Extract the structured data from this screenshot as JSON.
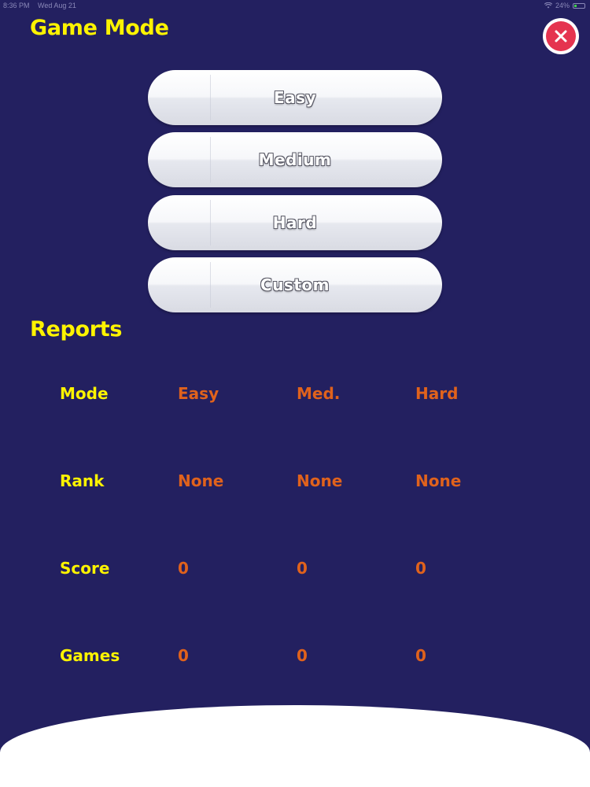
{
  "status_bar": {
    "time": "8:36 PM",
    "date": "Wed Aug 21",
    "battery": "24%"
  },
  "game_mode": {
    "title": "Game Mode",
    "buttons": [
      {
        "label": "Easy"
      },
      {
        "label": "Medium"
      },
      {
        "label": "Hard"
      },
      {
        "label": "Custom"
      }
    ]
  },
  "reports": {
    "title": "Reports",
    "rows": [
      {
        "label": "Mode",
        "values": [
          "Easy",
          "Med.",
          "Hard"
        ]
      },
      {
        "label": "Rank",
        "values": [
          "None",
          "None",
          "None"
        ]
      },
      {
        "label": "Score",
        "values": [
          "0",
          "0",
          "0"
        ]
      },
      {
        "label": "Games",
        "values": [
          "0",
          "0",
          "0"
        ]
      }
    ]
  },
  "icons": {
    "close": "close-icon",
    "wifi": "wifi-icon",
    "battery": "battery-icon"
  },
  "colors": {
    "background": "#232060",
    "title_yellow": "#fdf300",
    "value_orange": "#e0621c",
    "close_red": "#e5344f"
  }
}
